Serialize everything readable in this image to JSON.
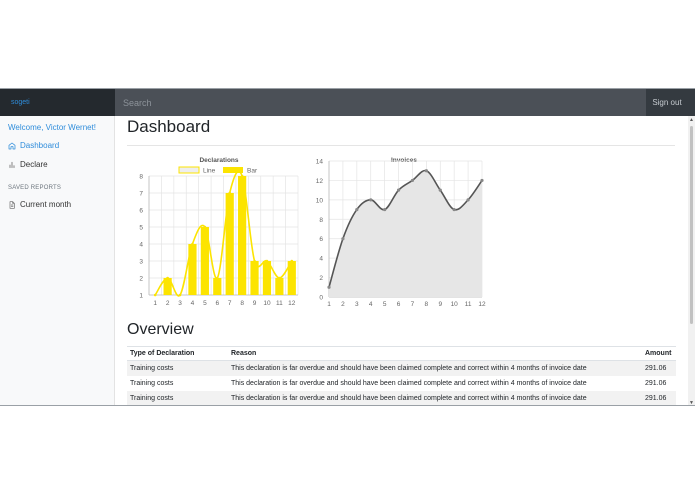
{
  "header": {
    "brand": "sogeti",
    "search_placeholder": "Search",
    "signout_label": "Sign out"
  },
  "sidebar": {
    "welcome": "Welcome, Victor Wernet!",
    "items": [
      {
        "label": "Dashboard",
        "icon": "home-icon",
        "active": true
      },
      {
        "label": "Declare",
        "icon": "bar-chart-icon",
        "active": false
      }
    ],
    "saved_heading": "SAVED REPORTS",
    "saved_items": [
      {
        "label": "Current month",
        "icon": "file-text-icon"
      }
    ]
  },
  "main": {
    "title": "Dashboard",
    "overview_title": "Overview",
    "table": {
      "headers": [
        "Type of Declaration",
        "Reason",
        "Amount"
      ],
      "rows": [
        [
          "Training costs",
          "This declaration is far overdue and should have been claimed complete and correct within 4 months of invoice date",
          "291.06"
        ],
        [
          "Training costs",
          "This declaration is far overdue and should have been claimed complete and correct within 4 months of invoice date",
          "291.06"
        ],
        [
          "Training costs",
          "This declaration is far overdue and should have been claimed complete and correct within 4 months of invoice date",
          "291.06"
        ]
      ]
    }
  },
  "colors": {
    "accent": "#2f8ddb",
    "bar_fill": "#fce400",
    "line_stroke": "#555555",
    "area_fill": "#e6e6e6"
  },
  "chart_data": [
    {
      "type": "bar",
      "title": "Declarations",
      "categories": [
        "1",
        "2",
        "3",
        "4",
        "5",
        "6",
        "7",
        "8",
        "9",
        "10",
        "11",
        "12"
      ],
      "series": [
        {
          "name": "Line",
          "type": "line",
          "values": [
            1,
            2,
            1,
            4,
            5,
            2,
            7,
            8,
            3,
            3,
            2,
            3
          ]
        },
        {
          "name": "Bar",
          "type": "bar",
          "values": [
            1,
            2,
            1,
            4,
            5,
            2,
            7,
            8,
            3,
            3,
            2,
            3
          ]
        }
      ],
      "ylim": [
        1,
        8
      ],
      "yticks": [
        1,
        2,
        3,
        4,
        5,
        6,
        7,
        8
      ],
      "grid": true,
      "legend": "top"
    },
    {
      "type": "area",
      "title": "Invoices",
      "x": [
        "1",
        "2",
        "3",
        "4",
        "5",
        "6",
        "7",
        "8",
        "9",
        "10",
        "11",
        "12"
      ],
      "values": [
        1,
        6,
        9,
        10,
        9,
        11,
        12,
        13,
        11,
        9,
        10,
        12
      ],
      "ylim": [
        0,
        14
      ],
      "yticks": [
        0,
        2,
        4,
        6,
        8,
        10,
        12,
        14
      ],
      "grid": true
    }
  ]
}
